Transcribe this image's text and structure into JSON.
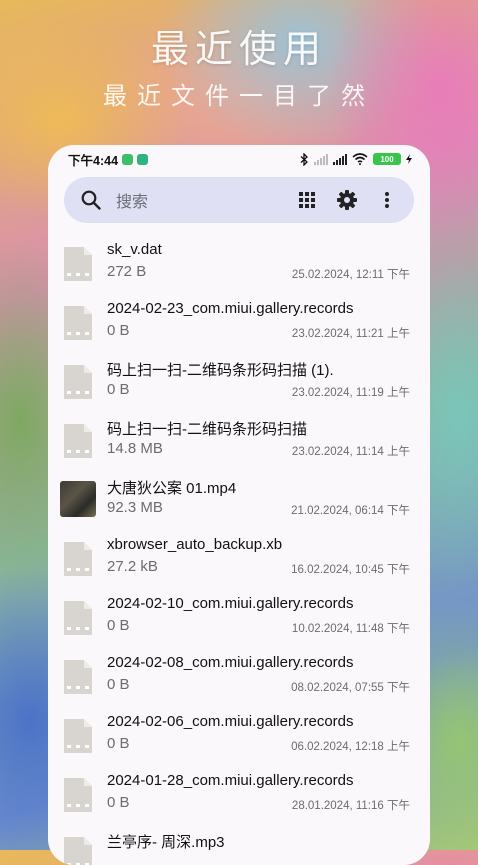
{
  "hero": {
    "title": "最近使用",
    "subtitle": "最近文件一目了然"
  },
  "statusbar": {
    "time": "下午4:44",
    "battery": "100"
  },
  "search": {
    "placeholder": "搜索",
    "icons": [
      "search-icon",
      "grid-view-icon",
      "settings-icon",
      "more-vert-icon"
    ]
  },
  "colors": {
    "card_bg": "#fbf8fb",
    "search_bg": "#dfe0f3",
    "battery": "#39c44c",
    "file_icon": "#d8d4cf"
  },
  "files": [
    {
      "name": "sk_v.dat",
      "size": "272 B",
      "date": "25.02.2024, 12:11 下午",
      "type": "file"
    },
    {
      "name": "2024-02-23_com.miui.gallery.records",
      "size": "0 B",
      "date": "23.02.2024, 11:21 上午",
      "type": "file"
    },
    {
      "name": "码上扫一扫-二维码条形码扫描 (1).",
      "size": "0 B",
      "date": "23.02.2024, 11:19 上午",
      "type": "file"
    },
    {
      "name": "码上扫一扫-二维码条形码扫描",
      "size": "14.8 MB",
      "date": "23.02.2024, 11:14 上午",
      "type": "file"
    },
    {
      "name": "大唐狄公案 01.mp4",
      "size": "92.3 MB",
      "date": "21.02.2024, 06:14 下午",
      "type": "video"
    },
    {
      "name": "xbrowser_auto_backup.xb",
      "size": "27.2 kB",
      "date": "16.02.2024, 10:45 下午",
      "type": "file"
    },
    {
      "name": "2024-02-10_com.miui.gallery.records",
      "size": "0 B",
      "date": "10.02.2024, 11:48 下午",
      "type": "file"
    },
    {
      "name": "2024-02-08_com.miui.gallery.records",
      "size": "0 B",
      "date": "08.02.2024, 07:55 下午",
      "type": "file"
    },
    {
      "name": "2024-02-06_com.miui.gallery.records",
      "size": "0 B",
      "date": "06.02.2024, 12:18 上午",
      "type": "file"
    },
    {
      "name": "2024-01-28_com.miui.gallery.records",
      "size": "0 B",
      "date": "28.01.2024, 11:16 下午",
      "type": "file"
    },
    {
      "name": "兰亭序- 周深.mp3",
      "size": "",
      "date": "",
      "type": "file"
    }
  ]
}
